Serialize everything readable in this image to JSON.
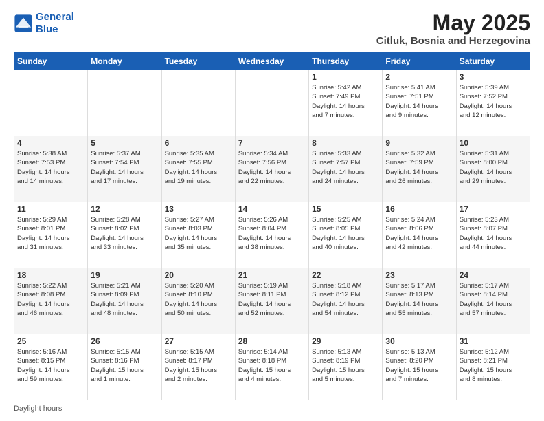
{
  "logo": {
    "line1": "General",
    "line2": "Blue"
  },
  "title": "May 2025",
  "subtitle": "Citluk, Bosnia and Herzegovina",
  "days_of_week": [
    "Sunday",
    "Monday",
    "Tuesday",
    "Wednesday",
    "Thursday",
    "Friday",
    "Saturday"
  ],
  "footer_label": "Daylight hours",
  "weeks": [
    [
      {
        "num": "",
        "info": ""
      },
      {
        "num": "",
        "info": ""
      },
      {
        "num": "",
        "info": ""
      },
      {
        "num": "",
        "info": ""
      },
      {
        "num": "1",
        "info": "Sunrise: 5:42 AM\nSunset: 7:49 PM\nDaylight: 14 hours\nand 7 minutes."
      },
      {
        "num": "2",
        "info": "Sunrise: 5:41 AM\nSunset: 7:51 PM\nDaylight: 14 hours\nand 9 minutes."
      },
      {
        "num": "3",
        "info": "Sunrise: 5:39 AM\nSunset: 7:52 PM\nDaylight: 14 hours\nand 12 minutes."
      }
    ],
    [
      {
        "num": "4",
        "info": "Sunrise: 5:38 AM\nSunset: 7:53 PM\nDaylight: 14 hours\nand 14 minutes."
      },
      {
        "num": "5",
        "info": "Sunrise: 5:37 AM\nSunset: 7:54 PM\nDaylight: 14 hours\nand 17 minutes."
      },
      {
        "num": "6",
        "info": "Sunrise: 5:35 AM\nSunset: 7:55 PM\nDaylight: 14 hours\nand 19 minutes."
      },
      {
        "num": "7",
        "info": "Sunrise: 5:34 AM\nSunset: 7:56 PM\nDaylight: 14 hours\nand 22 minutes."
      },
      {
        "num": "8",
        "info": "Sunrise: 5:33 AM\nSunset: 7:57 PM\nDaylight: 14 hours\nand 24 minutes."
      },
      {
        "num": "9",
        "info": "Sunrise: 5:32 AM\nSunset: 7:59 PM\nDaylight: 14 hours\nand 26 minutes."
      },
      {
        "num": "10",
        "info": "Sunrise: 5:31 AM\nSunset: 8:00 PM\nDaylight: 14 hours\nand 29 minutes."
      }
    ],
    [
      {
        "num": "11",
        "info": "Sunrise: 5:29 AM\nSunset: 8:01 PM\nDaylight: 14 hours\nand 31 minutes."
      },
      {
        "num": "12",
        "info": "Sunrise: 5:28 AM\nSunset: 8:02 PM\nDaylight: 14 hours\nand 33 minutes."
      },
      {
        "num": "13",
        "info": "Sunrise: 5:27 AM\nSunset: 8:03 PM\nDaylight: 14 hours\nand 35 minutes."
      },
      {
        "num": "14",
        "info": "Sunrise: 5:26 AM\nSunset: 8:04 PM\nDaylight: 14 hours\nand 38 minutes."
      },
      {
        "num": "15",
        "info": "Sunrise: 5:25 AM\nSunset: 8:05 PM\nDaylight: 14 hours\nand 40 minutes."
      },
      {
        "num": "16",
        "info": "Sunrise: 5:24 AM\nSunset: 8:06 PM\nDaylight: 14 hours\nand 42 minutes."
      },
      {
        "num": "17",
        "info": "Sunrise: 5:23 AM\nSunset: 8:07 PM\nDaylight: 14 hours\nand 44 minutes."
      }
    ],
    [
      {
        "num": "18",
        "info": "Sunrise: 5:22 AM\nSunset: 8:08 PM\nDaylight: 14 hours\nand 46 minutes."
      },
      {
        "num": "19",
        "info": "Sunrise: 5:21 AM\nSunset: 8:09 PM\nDaylight: 14 hours\nand 48 minutes."
      },
      {
        "num": "20",
        "info": "Sunrise: 5:20 AM\nSunset: 8:10 PM\nDaylight: 14 hours\nand 50 minutes."
      },
      {
        "num": "21",
        "info": "Sunrise: 5:19 AM\nSunset: 8:11 PM\nDaylight: 14 hours\nand 52 minutes."
      },
      {
        "num": "22",
        "info": "Sunrise: 5:18 AM\nSunset: 8:12 PM\nDaylight: 14 hours\nand 54 minutes."
      },
      {
        "num": "23",
        "info": "Sunrise: 5:17 AM\nSunset: 8:13 PM\nDaylight: 14 hours\nand 55 minutes."
      },
      {
        "num": "24",
        "info": "Sunrise: 5:17 AM\nSunset: 8:14 PM\nDaylight: 14 hours\nand 57 minutes."
      }
    ],
    [
      {
        "num": "25",
        "info": "Sunrise: 5:16 AM\nSunset: 8:15 PM\nDaylight: 14 hours\nand 59 minutes."
      },
      {
        "num": "26",
        "info": "Sunrise: 5:15 AM\nSunset: 8:16 PM\nDaylight: 15 hours\nand 1 minute."
      },
      {
        "num": "27",
        "info": "Sunrise: 5:15 AM\nSunset: 8:17 PM\nDaylight: 15 hours\nand 2 minutes."
      },
      {
        "num": "28",
        "info": "Sunrise: 5:14 AM\nSunset: 8:18 PM\nDaylight: 15 hours\nand 4 minutes."
      },
      {
        "num": "29",
        "info": "Sunrise: 5:13 AM\nSunset: 8:19 PM\nDaylight: 15 hours\nand 5 minutes."
      },
      {
        "num": "30",
        "info": "Sunrise: 5:13 AM\nSunset: 8:20 PM\nDaylight: 15 hours\nand 7 minutes."
      },
      {
        "num": "31",
        "info": "Sunrise: 5:12 AM\nSunset: 8:21 PM\nDaylight: 15 hours\nand 8 minutes."
      }
    ]
  ]
}
